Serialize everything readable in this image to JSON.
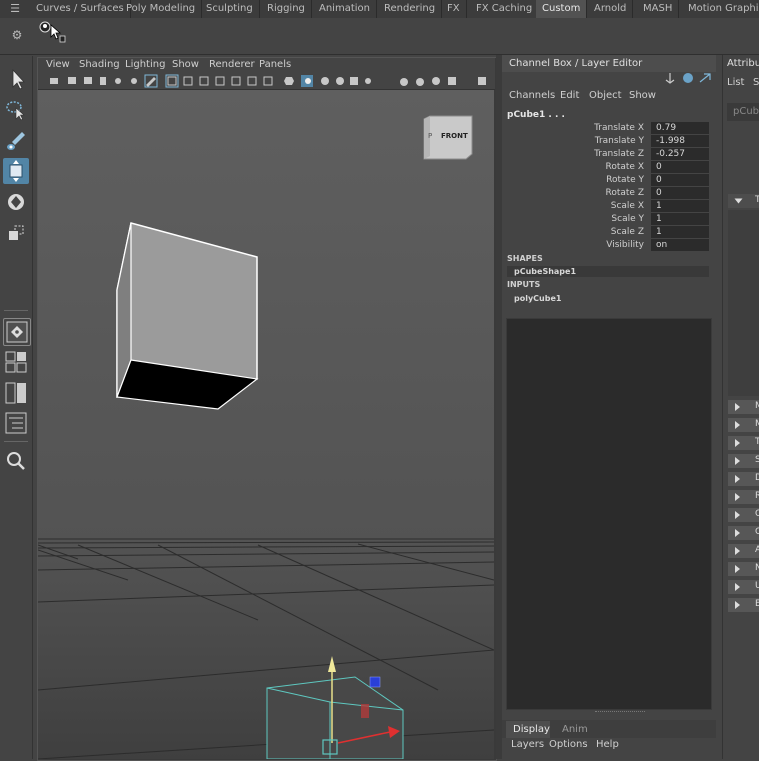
{
  "shelf": {
    "tabs": [
      "Curves / Surfaces",
      "Poly Modeling",
      "Sculpting",
      "Rigging",
      "Animation",
      "Rendering",
      "FX",
      "FX Caching",
      "Custom",
      "Arnold",
      "MASH",
      "Motion Graphics"
    ],
    "active_tab": "Custom"
  },
  "viewport": {
    "menus": [
      "View",
      "Shading",
      "Lighting",
      "Show",
      "Renderer",
      "Panels"
    ],
    "view_cube_label": "FRONT",
    "view_cube_side": "P"
  },
  "channel_box": {
    "title": "Channel Box / Layer Editor",
    "menus": [
      "Channels",
      "Edit",
      "Object",
      "Show"
    ],
    "node_name": "pCube1 . . .",
    "attributes": [
      {
        "label": "Translate X",
        "value": "0.79"
      },
      {
        "label": "Translate Y",
        "value": "-1.998"
      },
      {
        "label": "Translate Z",
        "value": "-0.257"
      },
      {
        "label": "Rotate X",
        "value": "0"
      },
      {
        "label": "Rotate Y",
        "value": "0"
      },
      {
        "label": "Rotate Z",
        "value": "0"
      },
      {
        "label": "Scale X",
        "value": "1"
      },
      {
        "label": "Scale Y",
        "value": "1"
      },
      {
        "label": "Scale Z",
        "value": "1"
      },
      {
        "label": "Visibility",
        "value": "on"
      }
    ],
    "shapes_header": "SHAPES",
    "shape_item": "pCubeShape1",
    "inputs_header": "INPUTS",
    "input_item": "polyCube1"
  },
  "layer_editor": {
    "tabs": [
      "Display",
      "Anim"
    ],
    "active_tab": "Display",
    "menus": [
      "Layers",
      "Options",
      "Help"
    ]
  },
  "attribute_editor": {
    "title": "Attribu",
    "list_label": "List",
    "second_label": "S",
    "node_tab": "pCubeT",
    "rows": [
      "T",
      "M",
      "M",
      "T",
      "S",
      "D",
      "R",
      "O",
      "O",
      "A",
      "N",
      "U",
      "E"
    ]
  },
  "colors": {
    "active_tab": "#525252",
    "active_tool": "#5285a6",
    "selection_wire": "#5ec8c0"
  },
  "icons": [
    "select-tool-icon",
    "lasso-tool-icon",
    "paint-select-icon",
    "move-tool-icon",
    "rotate-tool-icon",
    "scale-tool-icon",
    "layout-single-icon",
    "layout-four-icon",
    "layout-two-icon",
    "outliner-icon",
    "magnifier-icon",
    "settings-gear-icon"
  ]
}
